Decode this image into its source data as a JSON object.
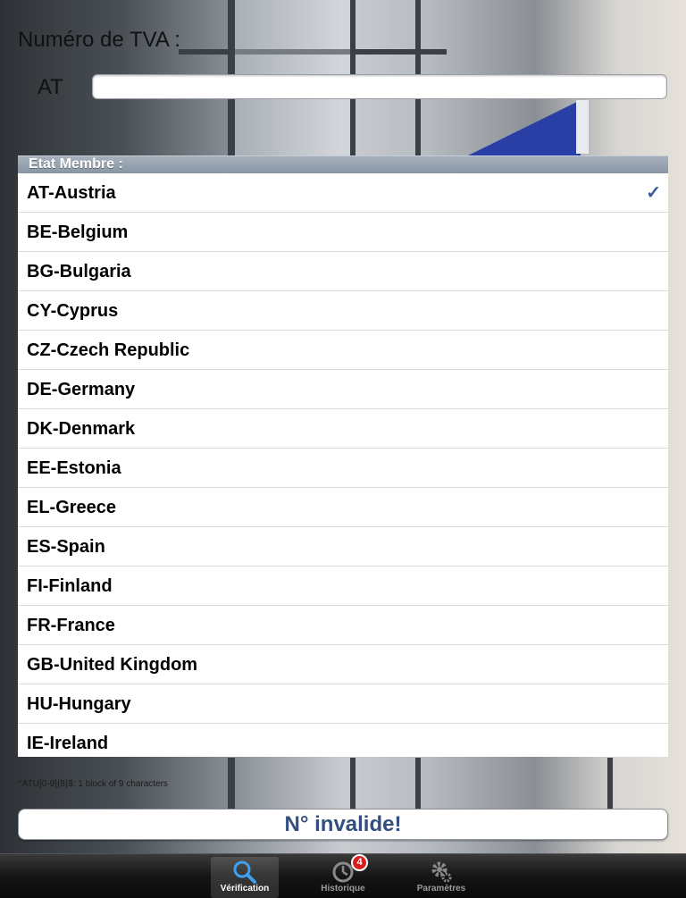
{
  "vat": {
    "title": "Numéro de TVA :",
    "country_code": "AT",
    "value": "",
    "placeholder": ""
  },
  "member_state": {
    "header": "Etat Membre :",
    "countries": [
      "AT-Austria",
      "BE-Belgium",
      "BG-Bulgaria",
      "CY-Cyprus",
      "CZ-Czech Republic",
      "DE-Germany",
      "DK-Denmark",
      "EE-Estonia",
      "EL-Greece",
      "ES-Spain",
      "FI-Finland",
      "FR-France",
      "GB-United Kingdom",
      "HU-Hungary",
      "IE-Ireland"
    ],
    "selected_index": 0,
    "checkmark": "✓"
  },
  "format_hint": "^ATU[0-9]{8}$: 1 block of 9 characters",
  "result": "N° invalide!",
  "tabs": [
    {
      "label": "Vérification",
      "icon": "magnifier-icon",
      "active": true
    },
    {
      "label": "Historique",
      "icon": "clock-icon",
      "active": false,
      "badge": "4"
    },
    {
      "label": "Paramètres",
      "icon": "gear-icon",
      "active": false
    }
  ],
  "colors": {
    "accent": "#324f7f",
    "checkmark": "#3a5a9a",
    "badge": "#d81e1e",
    "flag": "#2a3fa6"
  }
}
